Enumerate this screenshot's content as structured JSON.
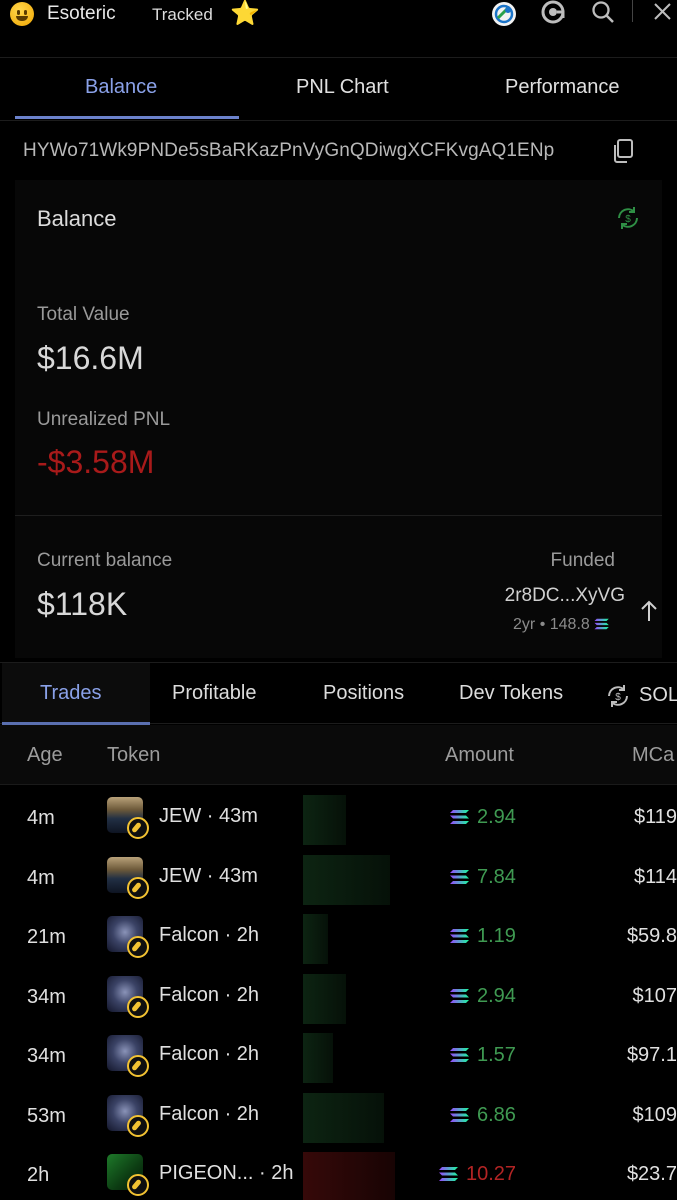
{
  "header": {
    "title": "Esoteric",
    "tracked": "Tracked",
    "star": "⭐"
  },
  "tabs": [
    {
      "label": "Balance",
      "active": true
    },
    {
      "label": "PNL Chart",
      "active": false
    },
    {
      "label": "Performance",
      "active": false
    }
  ],
  "wallet_address": "HYWo71Wk9PNDe5sBaRKazPnVyGnQDiwgXCFKvgAQ1ENp",
  "balance": {
    "title": "Balance",
    "total_value_label": "Total Value",
    "total_value": "$16.6M",
    "unrealized_pnl_label": "Unrealized PNL",
    "unrealized_pnl": "-$3.58M",
    "current_balance_label": "Current balance",
    "current_balance": "$118K",
    "funded_label": "Funded",
    "funded_address": "2r8DC...XyVG",
    "funded_age": "2yr",
    "funded_separator": "•",
    "funded_amount": "148.8"
  },
  "trade_tabs": [
    {
      "label": "Trades",
      "active": true
    },
    {
      "label": "Profitable",
      "active": false
    },
    {
      "label": "Positions",
      "active": false
    },
    {
      "label": "Dev Tokens",
      "active": false
    }
  ],
  "sol_toggle_label": "SOL",
  "table": {
    "columns": {
      "age": "Age",
      "token": "Token",
      "amount": "Amount",
      "mcap": "MCa"
    },
    "rows": [
      {
        "age": "4m",
        "token": "JEW · 43m",
        "amount": "2.94",
        "mcap": "$119",
        "side": "buy",
        "bar": 0.47
      },
      {
        "age": "4m",
        "token": "JEW · 43m",
        "amount": "7.84",
        "mcap": "$114",
        "side": "buy",
        "bar": 0.95
      },
      {
        "age": "21m",
        "token": "Falcon · 2h",
        "amount": "1.19",
        "mcap": "$59.8",
        "side": "buy",
        "bar": 0.27
      },
      {
        "age": "34m",
        "token": "Falcon · 2h",
        "amount": "2.94",
        "mcap": "$107",
        "side": "buy",
        "bar": 0.47
      },
      {
        "age": "34m",
        "token": "Falcon · 2h",
        "amount": "1.57",
        "mcap": "$97.1",
        "side": "buy",
        "bar": 0.33
      },
      {
        "age": "53m",
        "token": "Falcon · 2h",
        "amount": "6.86",
        "mcap": "$109",
        "side": "buy",
        "bar": 0.88
      },
      {
        "age": "2h",
        "token": "PIGEON... · 2h",
        "amount": "10.27",
        "mcap": "$23.7",
        "side": "sell",
        "bar": 1.0
      }
    ]
  },
  "colors": {
    "accent": "#8aa1e8",
    "positive": "#3f9a52",
    "negative": "#b22424",
    "background": "#000000"
  },
  "icons": [
    "smiley-icon",
    "globe-icon",
    "at-icon",
    "search-icon",
    "close-icon",
    "copy-icon",
    "refresh-dollar-icon",
    "solana-icon",
    "arrow-up-icon",
    "pill-icon"
  ]
}
